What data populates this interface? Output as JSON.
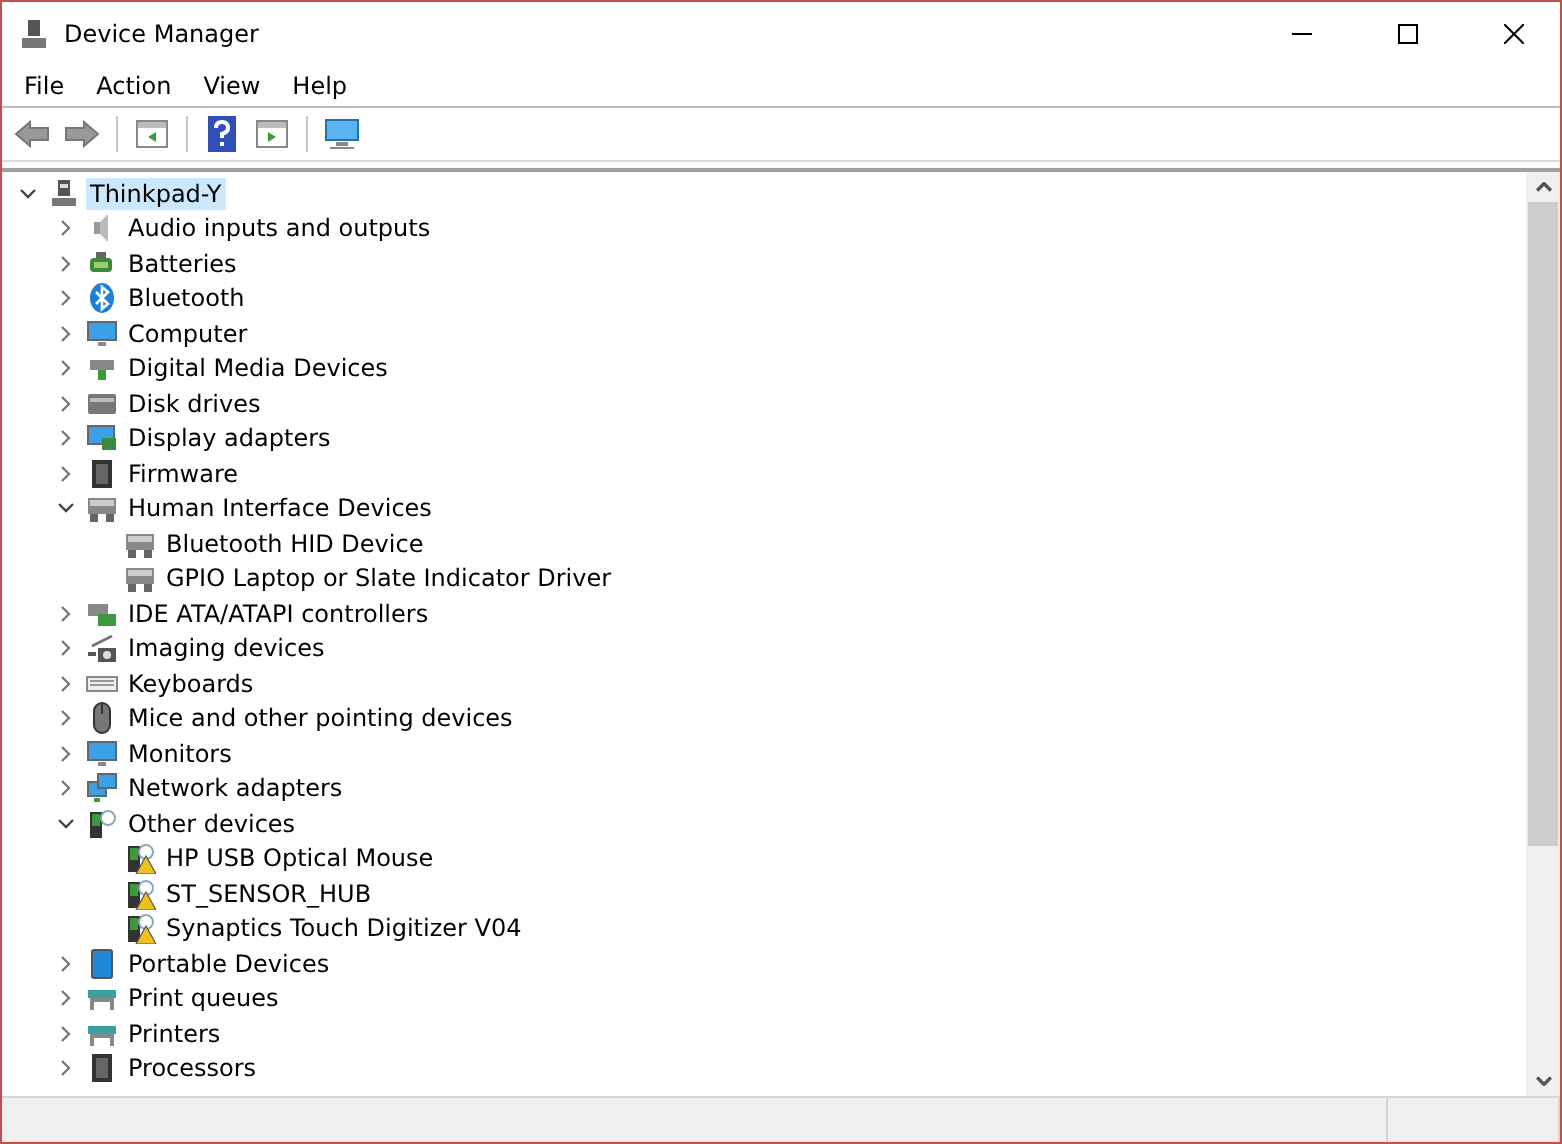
{
  "window": {
    "title": "Device Manager"
  },
  "menu": [
    "File",
    "Action",
    "View",
    "Help"
  ],
  "tree": {
    "label": "Thinkpad-Y",
    "kind": "computer",
    "expanded": true,
    "selected": true,
    "children": [
      {
        "label": "Audio inputs and outputs",
        "kind": "audio",
        "expanded": false,
        "selected": false
      },
      {
        "label": "Batteries",
        "kind": "battery",
        "expanded": false,
        "selected": false
      },
      {
        "label": "Bluetooth",
        "kind": "bluetooth",
        "expanded": false,
        "selected": false
      },
      {
        "label": "Computer",
        "kind": "monitor",
        "expanded": false,
        "selected": false
      },
      {
        "label": "Digital Media Devices",
        "kind": "media",
        "expanded": false,
        "selected": false
      },
      {
        "label": "Disk drives",
        "kind": "disk",
        "expanded": false,
        "selected": false
      },
      {
        "label": "Display adapters",
        "kind": "display",
        "expanded": false,
        "selected": false
      },
      {
        "label": "Firmware",
        "kind": "chip",
        "expanded": false,
        "selected": false
      },
      {
        "label": "Human Interface Devices",
        "kind": "hid",
        "expanded": true,
        "selected": false,
        "children": [
          {
            "label": "Bluetooth HID Device",
            "kind": "hid",
            "selected": false
          },
          {
            "label": "GPIO Laptop or Slate Indicator Driver",
            "kind": "hid",
            "selected": false
          }
        ]
      },
      {
        "label": "IDE ATA/ATAPI controllers",
        "kind": "card",
        "expanded": false,
        "selected": false
      },
      {
        "label": "Imaging devices",
        "kind": "camera",
        "expanded": false,
        "selected": false
      },
      {
        "label": "Keyboards",
        "kind": "keyboard",
        "expanded": false,
        "selected": false
      },
      {
        "label": "Mice and other pointing devices",
        "kind": "mouse",
        "expanded": false,
        "selected": false
      },
      {
        "label": "Monitors",
        "kind": "monitor",
        "expanded": false,
        "selected": false
      },
      {
        "label": "Network adapters",
        "kind": "network",
        "expanded": false,
        "selected": false
      },
      {
        "label": "Other devices",
        "kind": "unknown",
        "expanded": true,
        "selected": false,
        "children": [
          {
            "label": "HP USB Optical Mouse",
            "kind": "unknown",
            "warning": true,
            "selected": false
          },
          {
            "label": "ST_SENSOR_HUB",
            "kind": "unknown",
            "warning": true,
            "selected": false
          },
          {
            "label": "Synaptics Touch Digitizer V04",
            "kind": "unknown",
            "warning": true,
            "selected": false
          }
        ]
      },
      {
        "label": "Portable Devices",
        "kind": "portable",
        "expanded": false,
        "selected": false
      },
      {
        "label": "Print queues",
        "kind": "printer",
        "expanded": false,
        "selected": false
      },
      {
        "label": "Printers",
        "kind": "printer",
        "expanded": false,
        "selected": false
      },
      {
        "label": "Processors",
        "kind": "chip",
        "expanded": false,
        "selected": false
      }
    ]
  }
}
